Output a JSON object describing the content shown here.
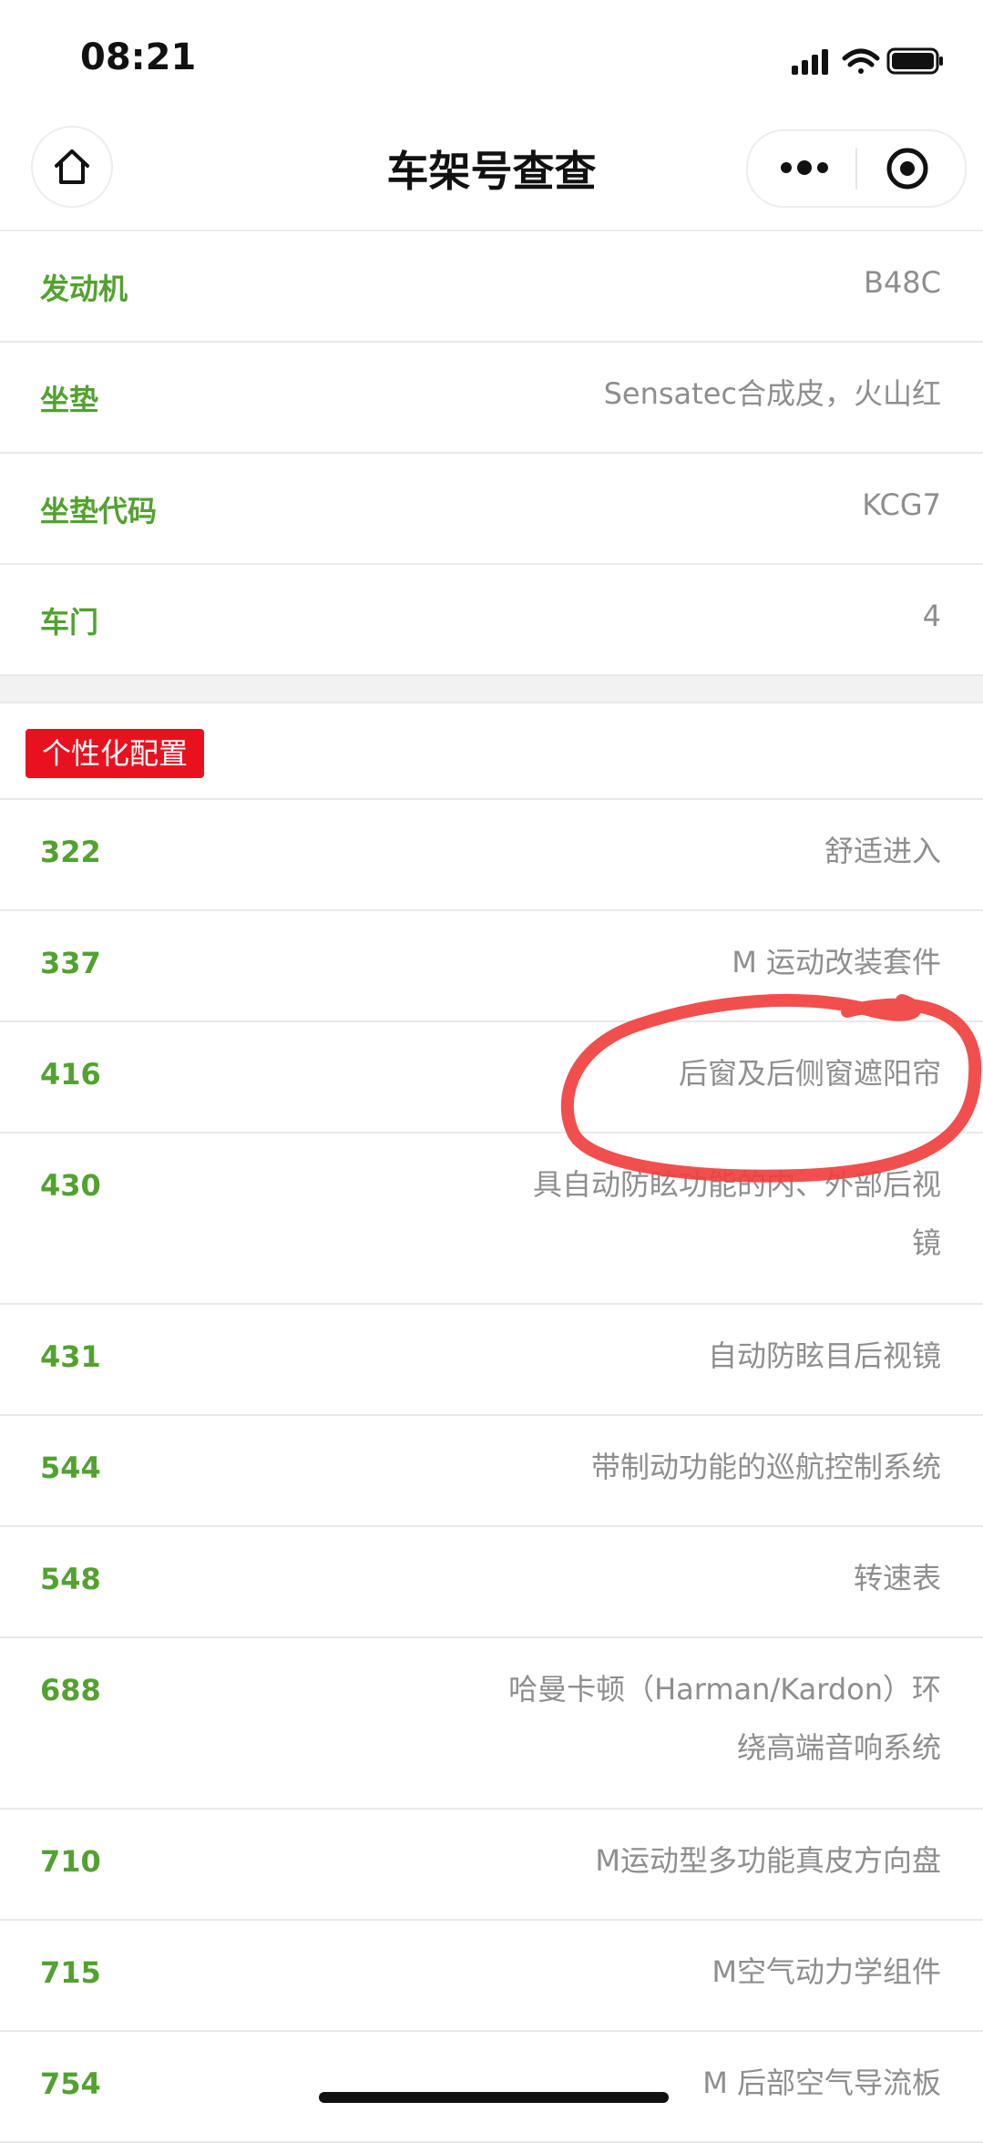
{
  "status_bar": {
    "time": "08:21"
  },
  "nav": {
    "title": "车架号查查"
  },
  "basic_rows": [
    {
      "label": "发动机",
      "value": "B48C"
    },
    {
      "label": "坐垫",
      "value": "Sensatec合成皮，火山红"
    },
    {
      "label": "坐垫代码",
      "value": "KCG7"
    },
    {
      "label": "车门",
      "value": "4"
    }
  ],
  "section": {
    "tag": "个性化配置"
  },
  "options": [
    {
      "code": "322",
      "name": "舒适进入"
    },
    {
      "code": "337",
      "name": "M 运动改装套件"
    },
    {
      "code": "416",
      "name": "后窗及后侧窗遮阳帘"
    },
    {
      "code": "430",
      "name_line1": "具自动防眩功能的内、外部后视",
      "name_line2": "镜"
    },
    {
      "code": "431",
      "name": "自动防眩目后视镜"
    },
    {
      "code": "544",
      "name": "带制动功能的巡航控制系统"
    },
    {
      "code": "548",
      "name": "转速表"
    },
    {
      "code": "688",
      "name_line1": "哈曼卡顿（Harman/Kardon）环",
      "name_line2": "绕高端音响系统"
    },
    {
      "code": "710",
      "name": "M运动型多功能真皮方向盘"
    },
    {
      "code": "715",
      "name": "M空气动力学组件"
    },
    {
      "code": "754",
      "name": "M 后部空气导流板"
    }
  ],
  "colors": {
    "label_green": "#53a130",
    "value_gray": "#8e8e8e",
    "tag_red": "#e9111f",
    "annotation_red": "#f0403f"
  },
  "icons": [
    "home-icon",
    "more-dots-icon",
    "close-target-icon",
    "signal-icon",
    "wifi-icon",
    "battery-icon"
  ]
}
